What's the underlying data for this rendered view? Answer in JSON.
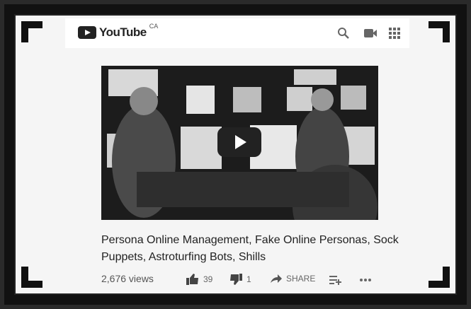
{
  "header": {
    "logo_text": "YouTube",
    "region": "CA",
    "icons": [
      "search-icon",
      "video-camera-icon",
      "apps-grid-icon"
    ]
  },
  "video": {
    "title": "Persona Online Management, Fake Online Personas, Sock Puppets, Astroturfing Bots, Shills",
    "views": "2,676 views",
    "likes": "39",
    "dislikes": "1",
    "share_label": "SHARE"
  },
  "colors": {
    "frame": "#111111",
    "page": "#f5f5f5",
    "icon": "#666666"
  }
}
